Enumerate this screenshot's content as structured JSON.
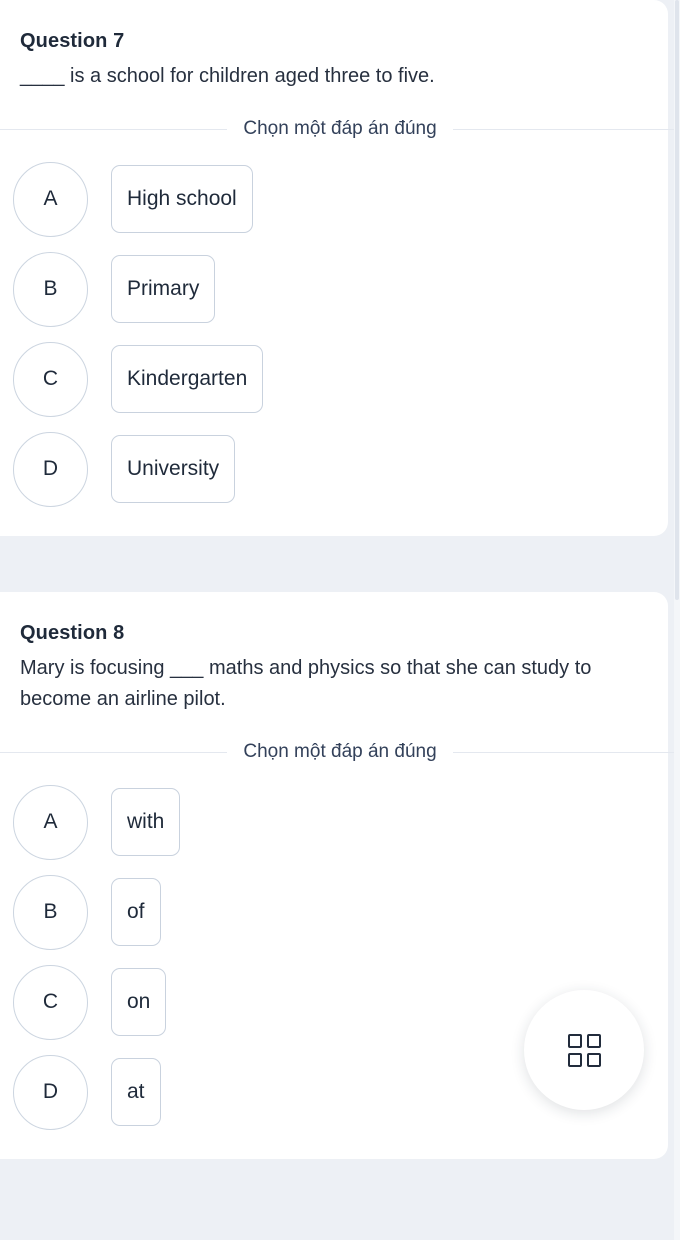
{
  "background_color": "#edf0f5",
  "card_color": "#ffffff",
  "text_color": "#1f2a3a",
  "border_color": "#c9d2de",
  "questions": [
    {
      "number_label": "Question 7",
      "prompt": "____ is a school for children aged three to five.",
      "choose_label": "Chọn một đáp án đúng",
      "options": [
        {
          "letter": "A",
          "text": "High school"
        },
        {
          "letter": "B",
          "text": "Primary"
        },
        {
          "letter": "C",
          "text": "Kindergarten"
        },
        {
          "letter": "D",
          "text": "University"
        }
      ]
    },
    {
      "number_label": "Question 8",
      "prompt": "Mary is focusing ___ maths and physics so that she can study to become an airline pilot.",
      "choose_label": "Chọn một đáp án đúng",
      "options": [
        {
          "letter": "A",
          "text": "with"
        },
        {
          "letter": "B",
          "text": "of"
        },
        {
          "letter": "C",
          "text": "on"
        },
        {
          "letter": "D",
          "text": "at"
        }
      ]
    }
  ],
  "fab": {
    "icon": "grid-2x2-icon"
  }
}
